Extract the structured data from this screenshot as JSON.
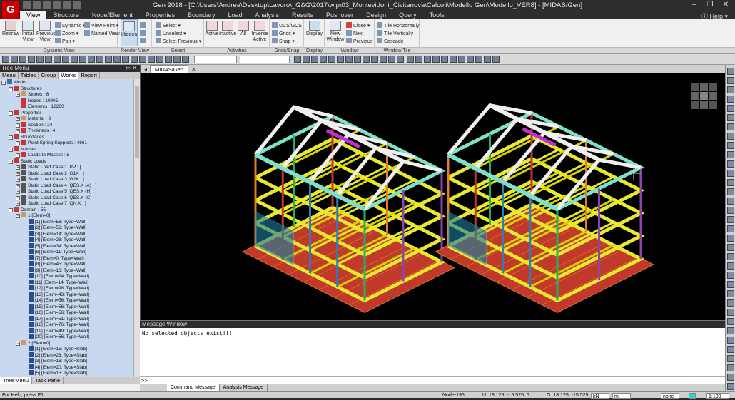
{
  "app": {
    "icon_letter": "G",
    "title": "Gen 2018 - [C:\\Users\\Andrea\\Desktop\\Lavoro\\_G&G\\2017\\wip\\03_Montevidoni_Civitanova\\Calcoli\\Modello Gen\\Modello_VER8] - [MIDAS/Gen]",
    "help_label": "Help"
  },
  "menu": {
    "items": [
      "View",
      "Structure",
      "Node/Element",
      "Properties",
      "Boundary",
      "Load",
      "Analysis",
      "Results",
      "Pushover",
      "Design",
      "Query",
      "Tools"
    ],
    "active": "View"
  },
  "ribbon": {
    "dynamic_view": {
      "redraw": "Redraw",
      "initial_view": "Initial View",
      "previous_view": "Previous View",
      "dynamic": "Dynamic",
      "zoom": "Zoom",
      "pan": "Pan",
      "view_point": "View Point",
      "named_view": "Named View",
      "group_label": "Dynamic View"
    },
    "render_view": {
      "hidden": "Hidden",
      "group_label": "Render View"
    },
    "select": {
      "select": "Select",
      "unselect": "Unselect",
      "select_previous": "Select Previous",
      "group_label": "Select"
    },
    "activities": {
      "active": "Active",
      "inactive": "Inactive",
      "all": "All",
      "inverse_active": "Inverse Active",
      "group_label": "Activities"
    },
    "grids_snap": {
      "ucs": "UCS/GCS",
      "grids": "Grids",
      "snap": "Snap",
      "group_label": "Grids/Snap"
    },
    "display": {
      "display": "Display",
      "group_label": "Display"
    },
    "window": {
      "new_window": "New Window",
      "close": "Close",
      "next": "Next",
      "previous": "Previous",
      "group_label": "Window"
    },
    "window_tile": {
      "tile_h": "Tile Horizontally",
      "tile_v": "Tile Vertically",
      "cascade": "Cascade",
      "group_label": "Window Tile"
    }
  },
  "tree": {
    "title": "Tree Menu",
    "tabs": [
      "Menu",
      "Tables",
      "Group",
      "Works",
      "Report"
    ],
    "active_tab": "Works",
    "footer_tabs": [
      "Tree Menu",
      "Task Pane"
    ],
    "rows": [
      {
        "indent": 0,
        "exp": "-",
        "icon": "#3a6fb0",
        "text": "Works"
      },
      {
        "indent": 1,
        "exp": "-",
        "icon": "#c33",
        "text": "Structures"
      },
      {
        "indent": 2,
        "exp": "+",
        "icon": "#c96",
        "text": "Stories : 6"
      },
      {
        "indent": 2,
        "exp": "",
        "icon": "#c33",
        "text": "Nodes : 10805"
      },
      {
        "indent": 2,
        "exp": "",
        "icon": "#c33",
        "text": "Elements : 12260"
      },
      {
        "indent": 1,
        "exp": "-",
        "icon": "#c33",
        "text": "Properties"
      },
      {
        "indent": 2,
        "exp": "+",
        "icon": "#c96",
        "text": "Material : 3"
      },
      {
        "indent": 2,
        "exp": "+",
        "icon": "#c33",
        "text": "Section : 24"
      },
      {
        "indent": 2,
        "exp": "+",
        "icon": "#c33",
        "text": "Thickness : 4"
      },
      {
        "indent": 1,
        "exp": "-",
        "icon": "#c33",
        "text": "Boundaries"
      },
      {
        "indent": 2,
        "exp": "+",
        "icon": "#c33",
        "text": "Point Spring Supports : 4661"
      },
      {
        "indent": 1,
        "exp": "-",
        "icon": "#c33",
        "text": "Masses"
      },
      {
        "indent": 2,
        "exp": "+",
        "icon": "#c33",
        "text": "Loads to Masses : 5"
      },
      {
        "indent": 1,
        "exp": "-",
        "icon": "#c33",
        "text": "Static Loads"
      },
      {
        "indent": 2,
        "exp": "+",
        "icon": "#555",
        "text": "Static Load Case 1 [PP : ]"
      },
      {
        "indent": 2,
        "exp": "+",
        "icon": "#555",
        "text": "Static Load Case 2 [G1K : ]"
      },
      {
        "indent": 2,
        "exp": "+",
        "icon": "#555",
        "text": "Static Load Case 3 [G2K : ]"
      },
      {
        "indent": 2,
        "exp": "+",
        "icon": "#555",
        "text": "Static Load Case 4 [QES.K (A) : ]"
      },
      {
        "indent": 2,
        "exp": "+",
        "icon": "#555",
        "text": "Static Load Case 5 [QES.K (H) : ]"
      },
      {
        "indent": 2,
        "exp": "+",
        "icon": "#555",
        "text": "Static Load Case 6 [QES.K (C) : ]"
      },
      {
        "indent": 2,
        "exp": "+",
        "icon": "#555",
        "text": "Static Load Case 7 [QN.K : ]"
      },
      {
        "indent": 1,
        "exp": "-",
        "icon": "#c33",
        "text": "Domain : 55"
      },
      {
        "indent": 2,
        "exp": "-",
        "icon": "#c96",
        "text": "1 [Elem=0]"
      },
      {
        "indent": 3,
        "exp": "",
        "icon": "#2a4f8f",
        "text": "[1] [Elem=56: Type=Wall]"
      },
      {
        "indent": 3,
        "exp": "",
        "icon": "#2a4f8f",
        "text": "[2] [Elem=56: Type=Wall]"
      },
      {
        "indent": 3,
        "exp": "",
        "icon": "#2a4f8f",
        "text": "[3] [Elem=14: Type=Wall]"
      },
      {
        "indent": 3,
        "exp": "",
        "icon": "#2a4f8f",
        "text": "[4] [Elem=28: Type=Wall]"
      },
      {
        "indent": 3,
        "exp": "",
        "icon": "#2a4f8f",
        "text": "[5] [Elem=34: Type=Wall]"
      },
      {
        "indent": 3,
        "exp": "",
        "icon": "#2a4f8f",
        "text": "[6] [Elem=11: Type=Wall]"
      },
      {
        "indent": 3,
        "exp": "",
        "icon": "#2a4f8f",
        "text": "[7] [Elem=0: Type=Wall]"
      },
      {
        "indent": 3,
        "exp": "",
        "icon": "#2a4f8f",
        "text": "[8] [Elem=45: Type=Wall]"
      },
      {
        "indent": 3,
        "exp": "",
        "icon": "#2a4f8f",
        "text": "[9] [Elem=16: Type=Wall]"
      },
      {
        "indent": 3,
        "exp": "",
        "icon": "#2a4f8f",
        "text": "[10] [Elem=24: Type=Wall]"
      },
      {
        "indent": 3,
        "exp": "",
        "icon": "#2a4f8f",
        "text": "[11] [Elem=14: Type=Wall]"
      },
      {
        "indent": 3,
        "exp": "",
        "icon": "#2a4f8f",
        "text": "[12] [Elem=98: Type=Wall]"
      },
      {
        "indent": 3,
        "exp": "",
        "icon": "#2a4f8f",
        "text": "[13] [Elem=43: Type=Wall]"
      },
      {
        "indent": 3,
        "exp": "",
        "icon": "#2a4f8f",
        "text": "[14] [Elem=56: Type=Wall]"
      },
      {
        "indent": 3,
        "exp": "",
        "icon": "#2a4f8f",
        "text": "[15] [Elem=56: Type=Wall]"
      },
      {
        "indent": 3,
        "exp": "",
        "icon": "#2a4f8f",
        "text": "[16] [Elem=56: Type=Wall]"
      },
      {
        "indent": 3,
        "exp": "",
        "icon": "#2a4f8f",
        "text": "[17] [Elem=51: Type=Wall]"
      },
      {
        "indent": 3,
        "exp": "",
        "icon": "#2a4f8f",
        "text": "[18] [Elem=76: Type=Wall]"
      },
      {
        "indent": 3,
        "exp": "",
        "icon": "#2a4f8f",
        "text": "[19] [Elem=49: Type=Wall]"
      },
      {
        "indent": 3,
        "exp": "",
        "icon": "#2a4f8f",
        "text": "[20] [Elem=56: Type=Wall]"
      },
      {
        "indent": 2,
        "exp": "-",
        "icon": "#c96",
        "text": "2 [Elem=0]"
      },
      {
        "indent": 3,
        "exp": "",
        "icon": "#2a4f8f",
        "text": "[1] [Elem=15: Type=Slab]"
      },
      {
        "indent": 3,
        "exp": "",
        "icon": "#2a4f8f",
        "text": "[2] [Elem=23: Type=Slab]"
      },
      {
        "indent": 3,
        "exp": "",
        "icon": "#2a4f8f",
        "text": "[3] [Elem=16: Type=Slab]"
      },
      {
        "indent": 3,
        "exp": "",
        "icon": "#2a4f8f",
        "text": "[4] [Elem=20: Type=Slab]"
      },
      {
        "indent": 3,
        "exp": "",
        "icon": "#2a4f8f",
        "text": "[5] [Elem=15: Type=Slab]"
      }
    ]
  },
  "document": {
    "tab": "MIDAS/Gen"
  },
  "message": {
    "title": "Message Window",
    "text": "No selected objects exist!!!",
    "prompt": ">>",
    "tabs": [
      "Command Message",
      "Analysis Message"
    ],
    "active_tab": "Command Message"
  },
  "status": {
    "help": "For Help, press F1",
    "node": "Node-196",
    "u": "U: 18.125, -15.525, 6",
    "g": "G: 18.125, -15.525, 6",
    "unit_force": "kN",
    "unit_len": "m",
    "mode": "none",
    "zoom": "1:100"
  }
}
